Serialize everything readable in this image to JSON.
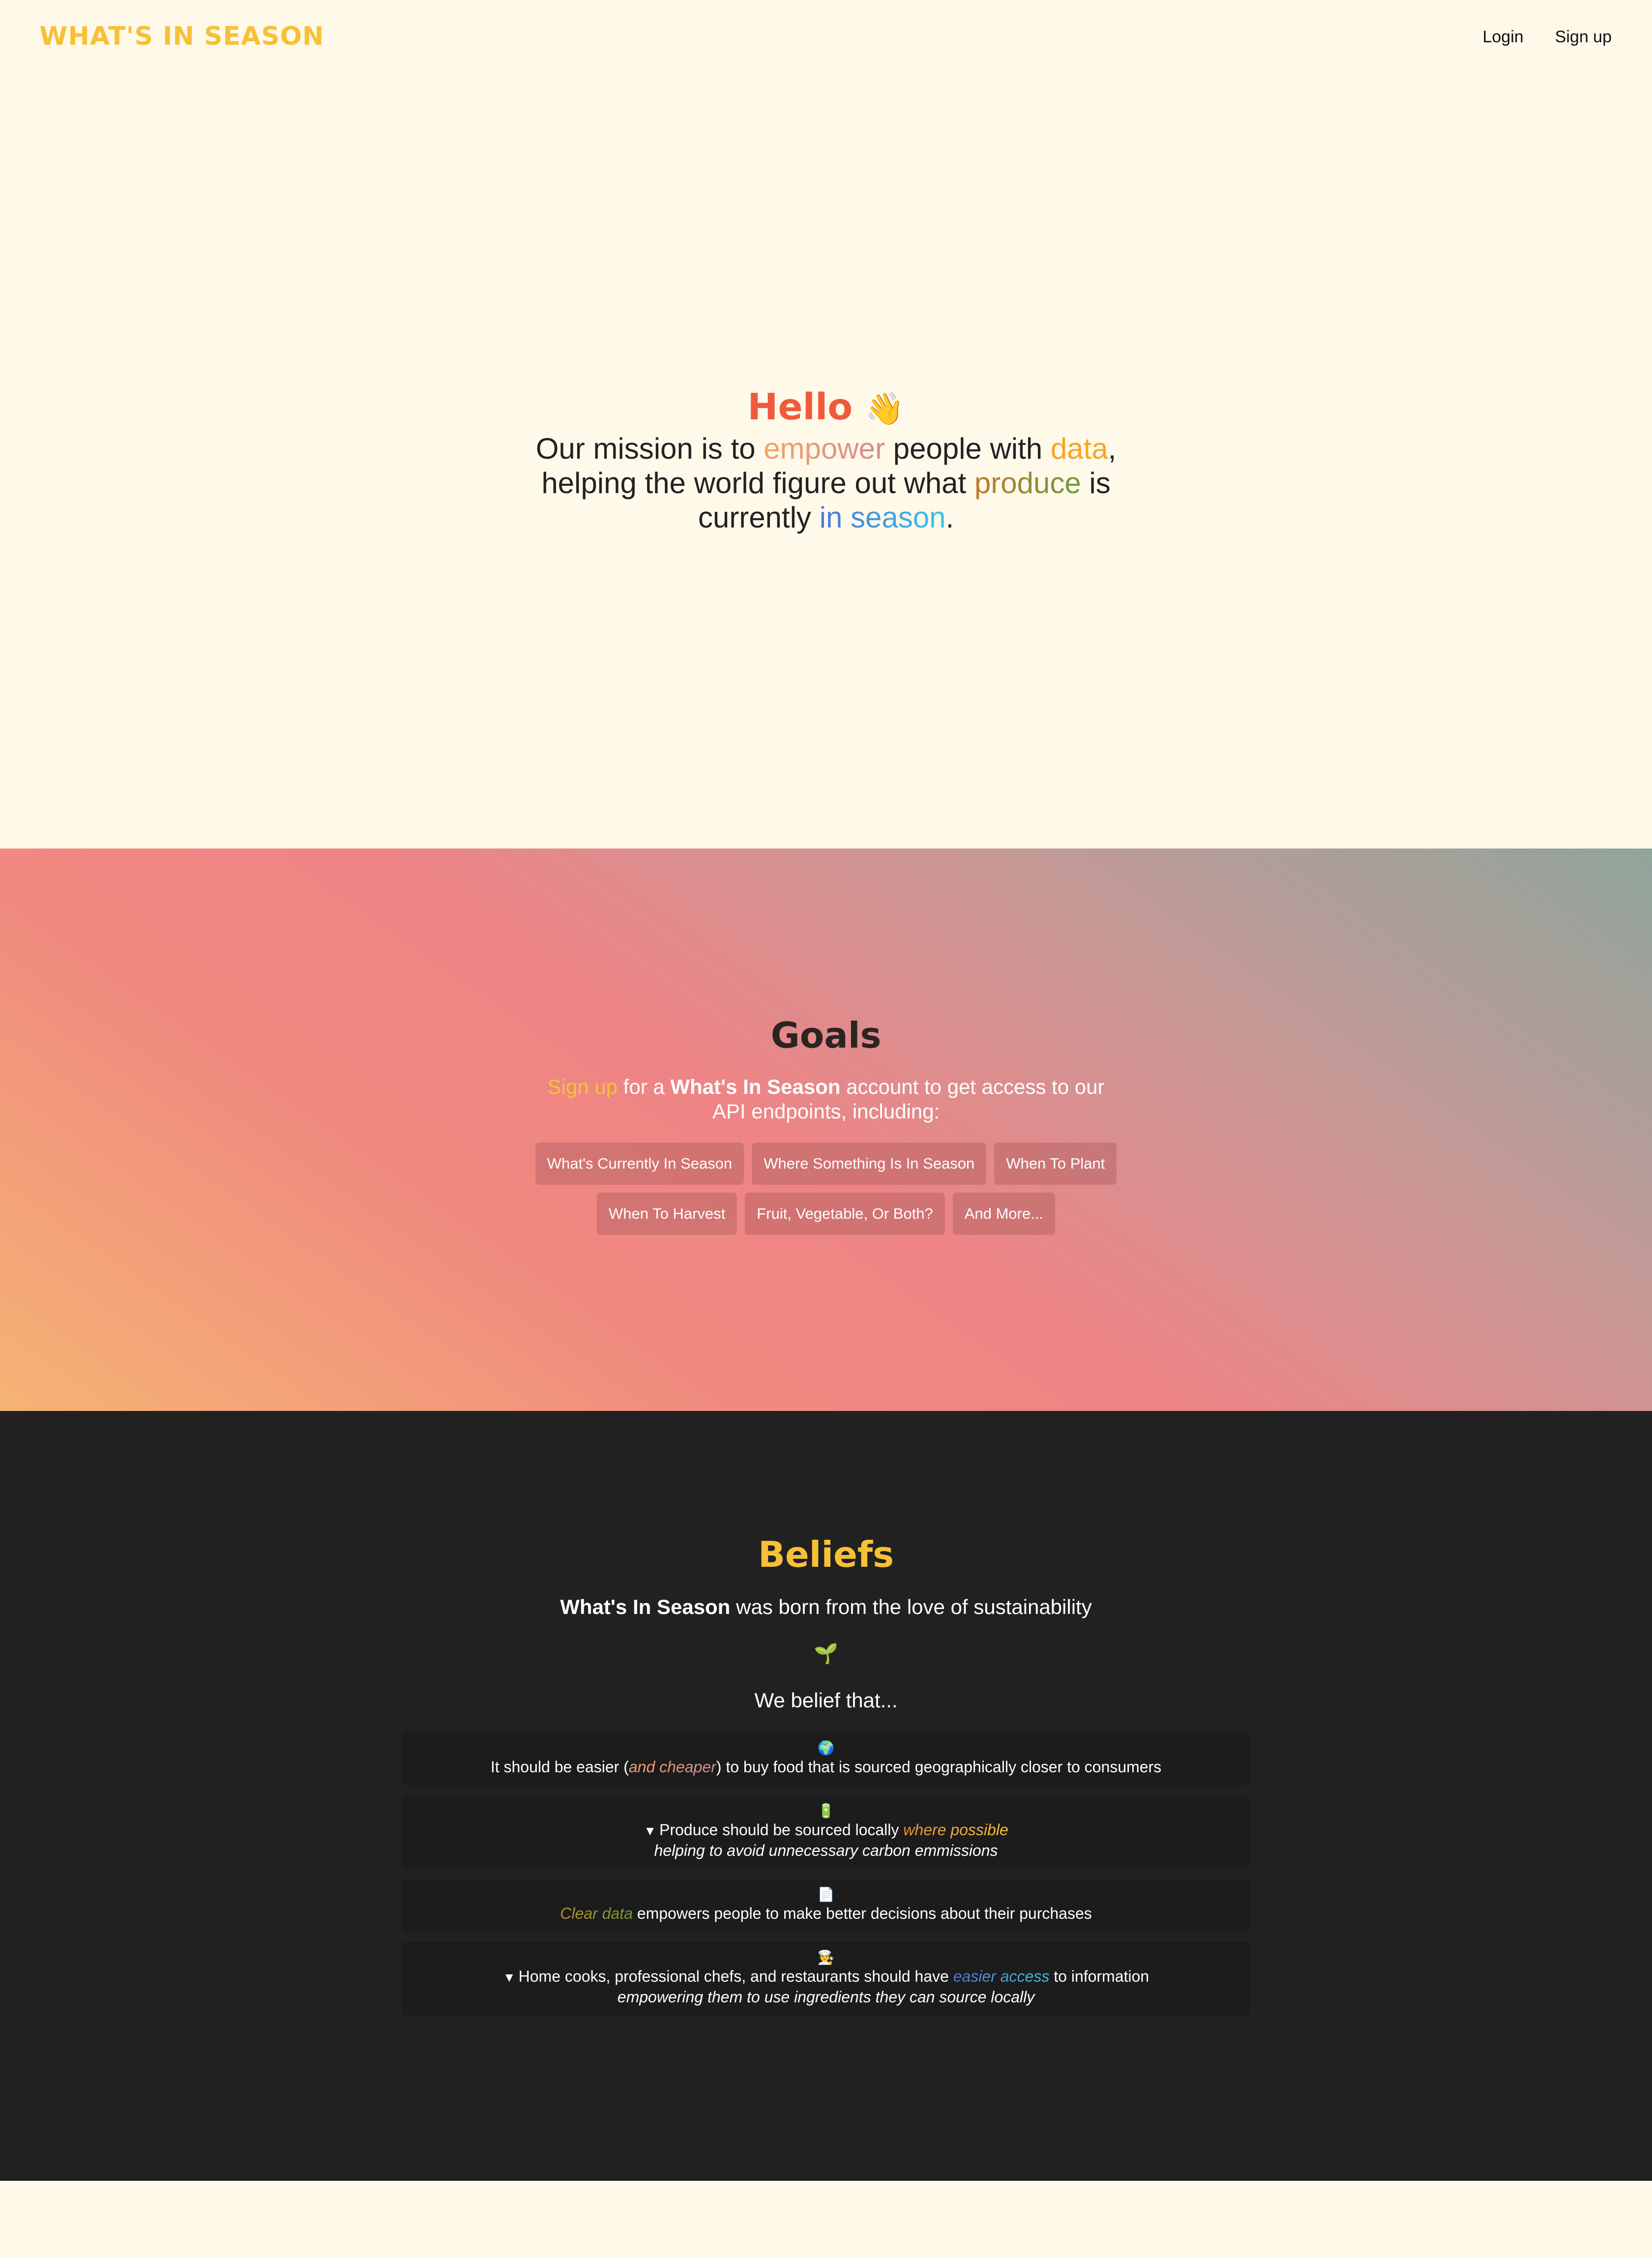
{
  "header": {
    "logo": "WHAT'S IN SEASON",
    "login": "Login",
    "signup": "Sign up"
  },
  "hero": {
    "hello": "Hello",
    "wave_emoji": "👋",
    "mission_1": "Our mission is to ",
    "mission_empower": "empower",
    "mission_2": " people with ",
    "mission_data": "data",
    "mission_3": ", helping the world figure out what ",
    "mission_produce": "produce",
    "mission_4": " is currently ",
    "mission_in_season": "in season",
    "mission_5": "."
  },
  "goals": {
    "title": "Goals",
    "sub_signup": "Sign up",
    "sub_1": " for a ",
    "sub_brand": "What's In Season",
    "sub_2": " account to get access to our API endpoints, including:",
    "chips_row1": [
      "What's Currently In Season",
      "Where Something Is In Season",
      "When To Plant"
    ],
    "chips_row2": [
      "When To Harvest",
      "Fruit, Vegetable, Or Both?",
      "And More..."
    ]
  },
  "beliefs": {
    "title": "Beliefs",
    "sub_brand": "What's In Season",
    "sub_rest": " was born from the love of sustainability",
    "sprout_emoji": "🌱",
    "belief_intro": "We belief that...",
    "cards": [
      {
        "icon": "🌍",
        "pre": "It should be easier (",
        "highlight": "and cheaper",
        "post": ") to buy food that is sourced geographically closer to consumers"
      },
      {
        "icon": "🔋",
        "marker": "▼",
        "pre": "Produce should be sourced locally ",
        "highlight": "where possible",
        "detail": "helping to avoid unnecessary carbon emmissions"
      },
      {
        "icon": "📄",
        "highlight": "Clear data",
        "post": " empowers people to make better decisions about their purchases"
      },
      {
        "icon": "🧑‍🍳",
        "marker": "▼",
        "pre": "Home cooks, professional chefs, and restaurants should have ",
        "highlight": "easier access",
        "post": " to information",
        "detail": "empowering them to use ingredients they can source locally"
      }
    ]
  },
  "colors": {
    "background": "#FFF9EA",
    "brand_yellow": "#F7C137",
    "hello_red": "#F05A3C",
    "dark_section": "#212121"
  }
}
